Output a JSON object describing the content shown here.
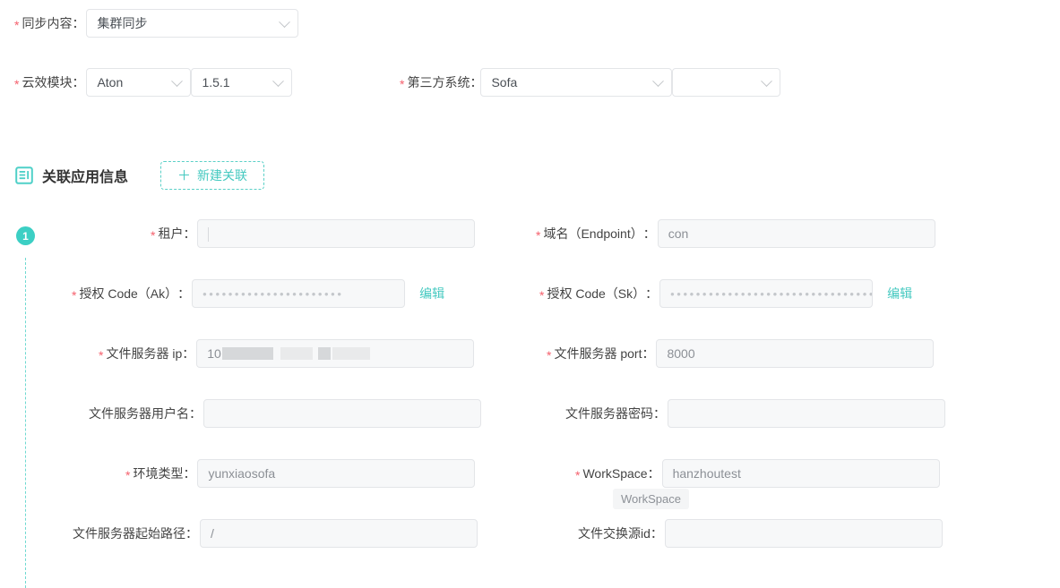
{
  "top_form": {
    "sync_content": {
      "label": "同步内容",
      "required": true,
      "value": "集群同步",
      "control": "select",
      "chevron_icon": "chevron-down-icon"
    },
    "cloud_module": {
      "label": "云效模块",
      "required": true,
      "value": "Aton",
      "version_value": "1.5.1",
      "control": "select",
      "chevron_icon": "chevron-down-icon"
    },
    "third_party_system": {
      "label": "第三方系统",
      "required": true,
      "value": "Sofa",
      "secondary_value": "",
      "control": "select",
      "chevron_icon": "chevron-down-icon"
    }
  },
  "section": {
    "icon": "document-list-icon",
    "title": "关联应用信息",
    "new_button": {
      "label": "新建关联",
      "plus_icon": "plus-icon"
    }
  },
  "group": {
    "index_badge": "1",
    "fields": {
      "tenant": {
        "label": "租户",
        "required": true,
        "value": "",
        "placeholder": ""
      },
      "endpoint": {
        "label": "域名（Endpoint）",
        "required": true,
        "value": "con"
      },
      "ak": {
        "label": "授权 Code（Ak）",
        "required": true,
        "masked_value": "••••••••••••••••••••••",
        "edit_label": "编辑"
      },
      "sk": {
        "label": "授权 Code（Sk）",
        "required": true,
        "masked_value": "••••••••••••••••••••••••••••••••",
        "edit_label": "编辑"
      },
      "file_server_ip": {
        "label": "文件服务器 ip",
        "required": true,
        "value_prefix": "10",
        "redacted": true
      },
      "file_server_port": {
        "label": "文件服务器 port",
        "required": true,
        "value": "8000"
      },
      "file_server_user": {
        "label": "文件服务器用户名",
        "required": false,
        "value": ""
      },
      "file_server_password": {
        "label": "文件服务器密码",
        "required": false,
        "value": ""
      },
      "env_type": {
        "label": "环境类型",
        "required": true,
        "value": "yunxiaosofa"
      },
      "workspace": {
        "label": "WorkSpace",
        "required": true,
        "value": "hanzhoutest",
        "tooltip": "WorkSpace"
      },
      "file_server_root_path": {
        "label": "文件服务器起始路径",
        "required": false,
        "value": "/"
      },
      "file_exchange_source_id": {
        "label": "文件交换源id",
        "required": false,
        "value": ""
      }
    }
  },
  "colors": {
    "accent_teal": "#3ccfc4",
    "required_red": "#f5606d",
    "field_bg": "#f7f8f9",
    "field_border": "#e3e5e8",
    "text": "#333333",
    "placeholder": "#b9bcc0"
  }
}
